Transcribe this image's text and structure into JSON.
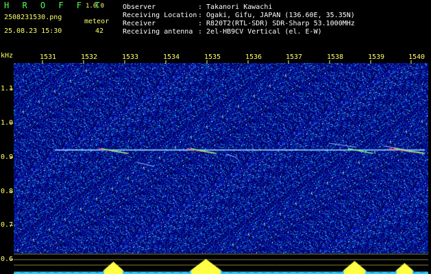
{
  "header": {
    "brand": "H R O F F T",
    "version": "1.0.0",
    "filename": "2508231530.png",
    "meteor_label": "meteor",
    "datetime": "25.08.23 15:30",
    "meteor_count": "42",
    "info": [
      {
        "label": "Observer",
        "value": ": Takanori Kawachi"
      },
      {
        "label": "Receiving Location",
        "value": ": Ogaki, Gifu, JAPAN (136.60E, 35.35N)"
      },
      {
        "label": "Receiver",
        "value": ": R820T2(RTL-SDR) SDR-Sharp 53.1000MHz"
      },
      {
        "label": "Receiving antenna",
        "value": ": 2el-HB9CV Vertical (el. E-W)"
      }
    ]
  },
  "axis": {
    "freq_unit": "kHz",
    "time_ticks": [
      "1531",
      "1532",
      "1533",
      "1534",
      "1535",
      "1536",
      "1537",
      "1538",
      "1539",
      "1540"
    ],
    "freq_ticks": [
      "1.1",
      "1.0",
      "0.9",
      "0.8",
      "0.7",
      "0.6"
    ]
  },
  "colors": {
    "background": "#000000",
    "label_yellow": "#ffff66",
    "brand_green": "#55ff55",
    "noise_blue": "#1a2bd6",
    "carrier": "#9fe8ff",
    "echo_red": "#ff3b6b",
    "echo_green": "#7dff8a"
  }
}
